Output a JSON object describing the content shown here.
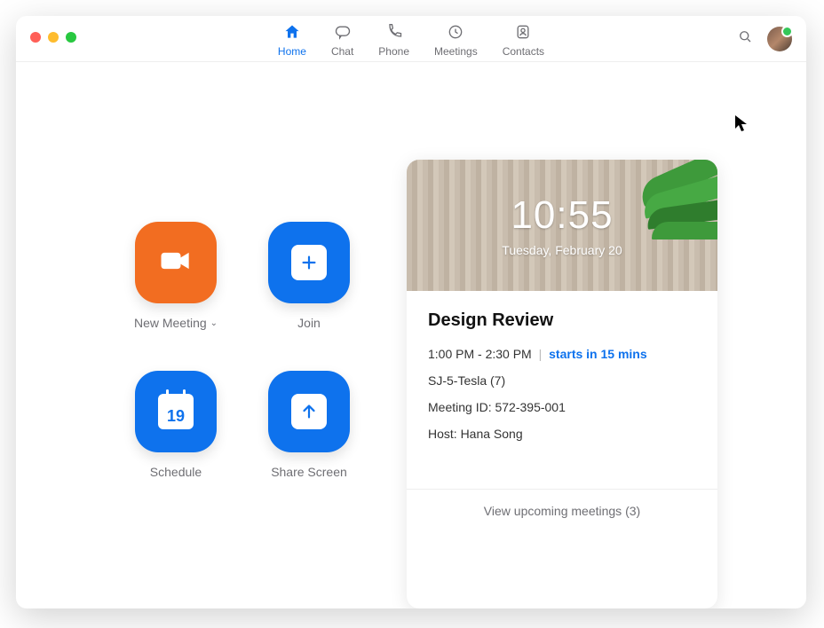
{
  "nav": {
    "tabs": [
      {
        "label": "Home"
      },
      {
        "label": "Chat"
      },
      {
        "label": "Phone"
      },
      {
        "label": "Meetings"
      },
      {
        "label": "Contacts"
      }
    ]
  },
  "actions": {
    "new_meeting": "New Meeting",
    "join": "Join",
    "schedule": "Schedule",
    "schedule_day": "19",
    "share_screen": "Share Screen"
  },
  "clock": {
    "time": "10:55",
    "date": "Tuesday, February 20"
  },
  "event": {
    "title": "Design Review",
    "time_range": "1:00 PM - 2:30 PM",
    "separator": "|",
    "starts_in": "starts in 15 mins",
    "room": "SJ-5-Tesla (7)",
    "meeting_id_line": "Meeting ID: 572-395-001",
    "host_line": "Host: Hana Song"
  },
  "footer": {
    "upcoming": "View upcoming meetings (3)"
  }
}
